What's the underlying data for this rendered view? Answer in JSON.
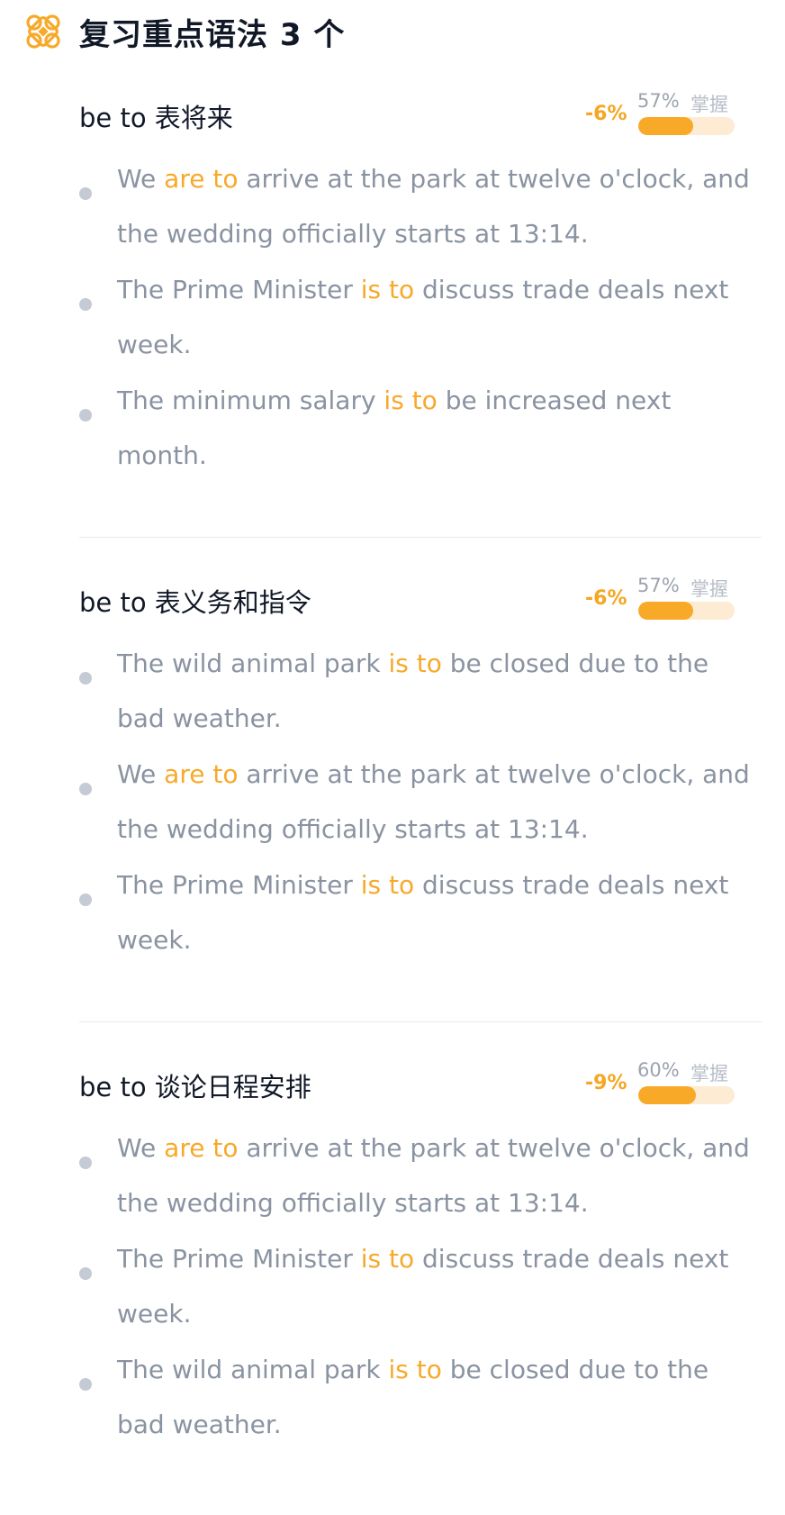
{
  "header": {
    "icon": "clover-knot-icon",
    "title": "复习重点语法 3 个"
  },
  "colors": {
    "accent": "#f7a92a",
    "text_primary": "#111827",
    "text_secondary": "#8a93a1",
    "bar_track": "#fdebd3"
  },
  "sections": [
    {
      "title": "be to 表将来",
      "delta": "-6%",
      "percent": "57%",
      "mastery_label": "掌握",
      "mastery_fraction": 0.57,
      "examples": [
        {
          "before": "We ",
          "highlight": "are to",
          "after": " arrive at the park at twelve o'clock, and the wedding officially starts at 13:14."
        },
        {
          "before": "The Prime Minister ",
          "highlight": "is to",
          "after": " discuss trade deals next week."
        },
        {
          "before": "The minimum salary ",
          "highlight": "is to",
          "after": " be increased next month."
        }
      ]
    },
    {
      "title": "be to 表义务和指令",
      "delta": "-6%",
      "percent": "57%",
      "mastery_label": "掌握",
      "mastery_fraction": 0.57,
      "examples": [
        {
          "before": "The wild animal park ",
          "highlight": "is to",
          "after": " be closed due to the bad weather."
        },
        {
          "before": "We ",
          "highlight": "are to",
          "after": " arrive at the park at twelve o'clock, and the wedding officially starts at 13:14."
        },
        {
          "before": "The Prime Minister ",
          "highlight": "is to",
          "after": " discuss trade deals next week."
        }
      ]
    },
    {
      "title": "be to 谈论日程安排",
      "delta": "-9%",
      "percent": "60%",
      "mastery_label": "掌握",
      "mastery_fraction": 0.6,
      "examples": [
        {
          "before": "We ",
          "highlight": "are to",
          "after": " arrive at the park at twelve o'clock, and the wedding officially starts at 13:14."
        },
        {
          "before": "The Prime Minister ",
          "highlight": "is to",
          "after": " discuss trade deals next week."
        },
        {
          "before": "The wild animal park ",
          "highlight": "is to",
          "after": " be closed due to the bad weather."
        }
      ]
    }
  ]
}
